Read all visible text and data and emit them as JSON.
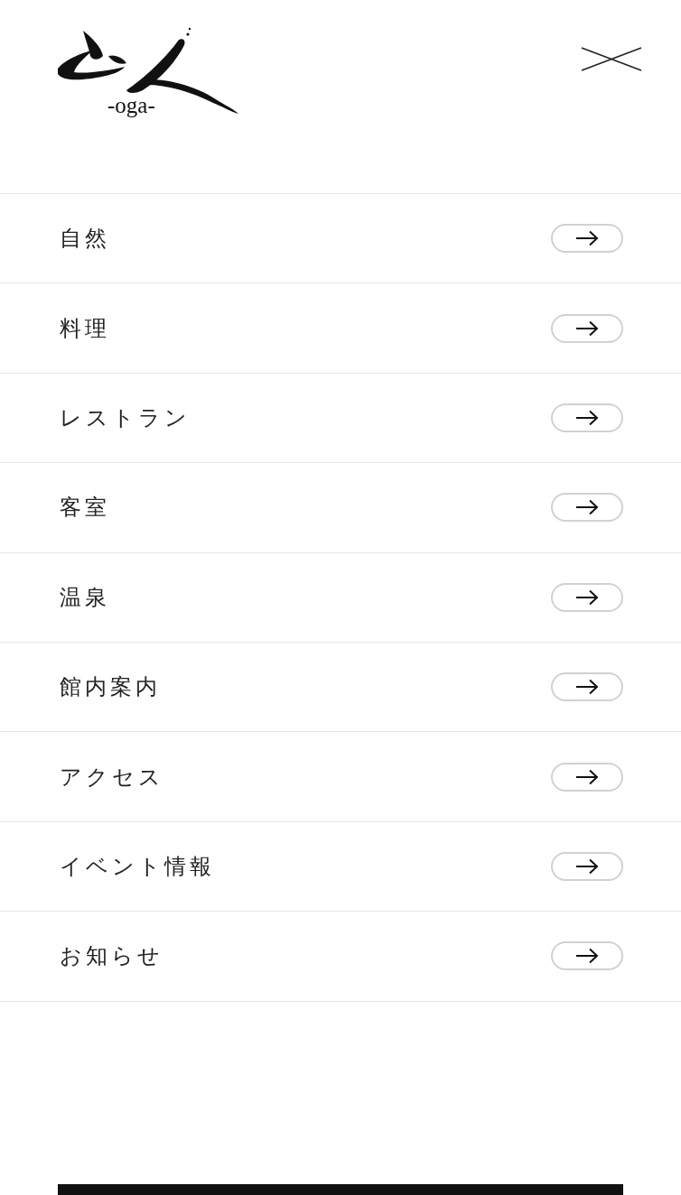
{
  "logo": {
    "subtitle": "-oga-"
  },
  "menu": {
    "items": [
      {
        "label": "自然"
      },
      {
        "label": "料理"
      },
      {
        "label": "レストラン"
      },
      {
        "label": "客室"
      },
      {
        "label": "温泉"
      },
      {
        "label": "館内案内"
      },
      {
        "label": "アクセス"
      },
      {
        "label": "イベント情報"
      },
      {
        "label": "お知らせ"
      }
    ]
  }
}
